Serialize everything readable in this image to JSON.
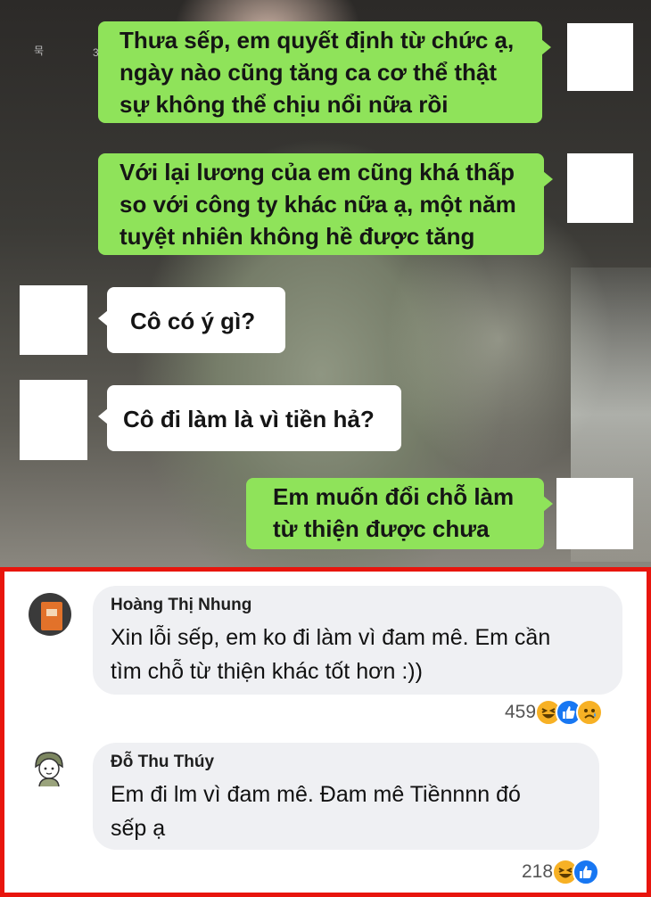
{
  "chat": {
    "corner_marks": [
      "묵",
      "3"
    ],
    "messages": [
      {
        "side": "right",
        "lines": [
          "Thưa sếp, em quyết định từ chức ạ,",
          "ngày nào cũng tăng ca cơ thể thật",
          "sự không thể chịu nổi nữa rồi"
        ]
      },
      {
        "side": "right",
        "lines": [
          "Với lại lương của em cũng khá thấp",
          "so với công ty khác nữa ạ, một năm",
          "tuyệt nhiên không hề được tăng"
        ]
      },
      {
        "side": "left",
        "lines": [
          "Cô có ý gì?"
        ]
      },
      {
        "side": "left",
        "lines": [
          "Cô đi làm là vì tiền hả?"
        ]
      },
      {
        "side": "right",
        "lines": [
          "Em muốn đổi chỗ làm",
          "từ thiện được chưa"
        ]
      }
    ]
  },
  "comments": [
    {
      "name": "Hoàng Thị Nhung",
      "lines": [
        "Xin lỗi sếp, em ko đi làm vì đam mê. Em cần",
        "tìm chỗ từ thiện khác tốt hơn :))"
      ],
      "reaction_count": "459",
      "reactions": [
        "haha-icon",
        "like-icon",
        "sad-icon"
      ]
    },
    {
      "name": "Đỗ Thu Thúy",
      "lines": [
        "Em đi lm vì đam mê. Đam mê Tiềnnnn đó",
        "sếp ạ"
      ],
      "reaction_count": "218",
      "reactions": [
        "haha-icon",
        "like-icon"
      ]
    }
  ],
  "colors": {
    "chat_green": "#8fe35a",
    "frame_red": "#e8150d",
    "comment_bg": "#eff0f3",
    "like_blue": "#1877f2",
    "haha_yellow": "#f7b125"
  }
}
